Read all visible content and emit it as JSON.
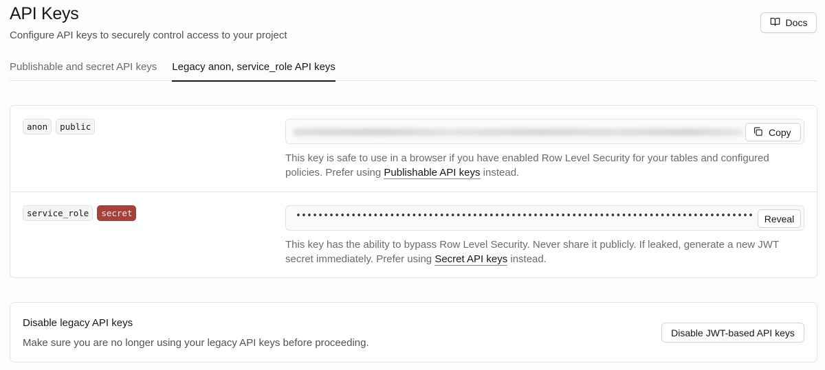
{
  "header": {
    "title": "API Keys",
    "subtitle": "Configure API keys to securely control access to your project",
    "docs_label": "Docs",
    "docs_icon": "book-open-icon"
  },
  "tabs": [
    {
      "label": "Publishable and secret API keys",
      "active": false
    },
    {
      "label": "Legacy anon, service_role API keys",
      "active": true
    }
  ],
  "keys": {
    "anon": {
      "badges": [
        "anon",
        "public"
      ],
      "key_display": "blurred",
      "copy_label": "Copy",
      "copy_icon": "copy-icon",
      "desc_before": "This key is safe to use in a browser if you have enabled Row Level Security for your tables and configured policies. Prefer using ",
      "desc_link": "Publishable API keys",
      "desc_after": " instead."
    },
    "service_role": {
      "badges": [
        "service_role",
        "secret"
      ],
      "masked_value": "••••••••••••••••••••••••••••••••••••••••••••••••••••••••••••••••••••••••••••••••••••••••••",
      "reveal_label": "Reveal",
      "desc_before": "This key has the ability to bypass Row Level Security. Never share it publicly. If leaked, generate a new JWT secret immediately. Prefer using ",
      "desc_link": "Secret API keys",
      "desc_after": " instead."
    }
  },
  "disable_section": {
    "title": "Disable legacy API keys",
    "description": "Make sure you are no longer using your legacy API keys before proceeding.",
    "button_label": "Disable JWT-based API keys"
  },
  "colors": {
    "secret_badge_bg": "#a7413a",
    "active_tab_underline": "#171717"
  }
}
